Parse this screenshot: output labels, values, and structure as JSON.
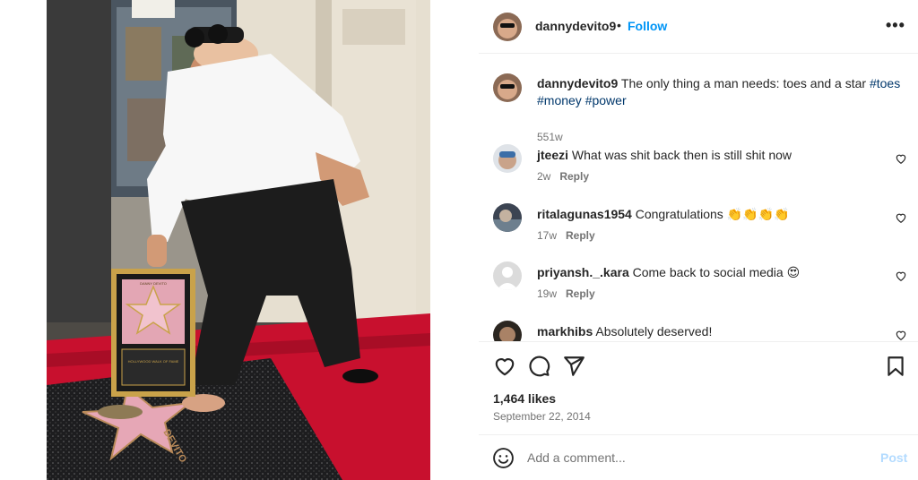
{
  "post": {
    "author": "dannydevito9",
    "follow_label": "Follow",
    "separator": "•",
    "more_label": "•••"
  },
  "caption": {
    "username": "dannydevito9",
    "text": "The only thing a man needs: toes and a star",
    "hashtags": [
      "#toes",
      "#money",
      "#power"
    ],
    "time": "551w"
  },
  "comments": [
    {
      "username": "jteezi",
      "text": "What was shit back then is still shit now",
      "time": "2w",
      "reply_label": "Reply"
    },
    {
      "username": "ritalagunas1954",
      "text": "Congratulations 👏👏👏👏",
      "time": "17w",
      "reply_label": "Reply"
    },
    {
      "username": "priyansh._.kara",
      "text": "Come back to social media 😍",
      "time": "19w",
      "reply_label": "Reply"
    },
    {
      "username": "markhibs",
      "text": "Absolutely deserved!",
      "time": "",
      "reply_label": ""
    }
  ],
  "engagement": {
    "likes": "1,464 likes",
    "date": "September 22, 2014"
  },
  "add_comment": {
    "placeholder": "Add a comment...",
    "post_label": "Post"
  },
  "photo": {
    "plaque_title": "DANNY DEVITO",
    "plaque_caption": "HOLLYWOOD WALK OF FAME",
    "star_name": "DEVITO"
  },
  "icons": {
    "like": "heart-icon",
    "comment": "comment-bubble-icon",
    "share": "paper-plane-icon",
    "save": "bookmark-icon",
    "emoji": "smiley-face-icon",
    "more": "more-dots-icon"
  },
  "colors": {
    "accent": "#0095f6",
    "hashtag": "#00376b",
    "muted": "#737373",
    "post_disabled": "#b3dbff",
    "carpet": "#c8102e"
  }
}
